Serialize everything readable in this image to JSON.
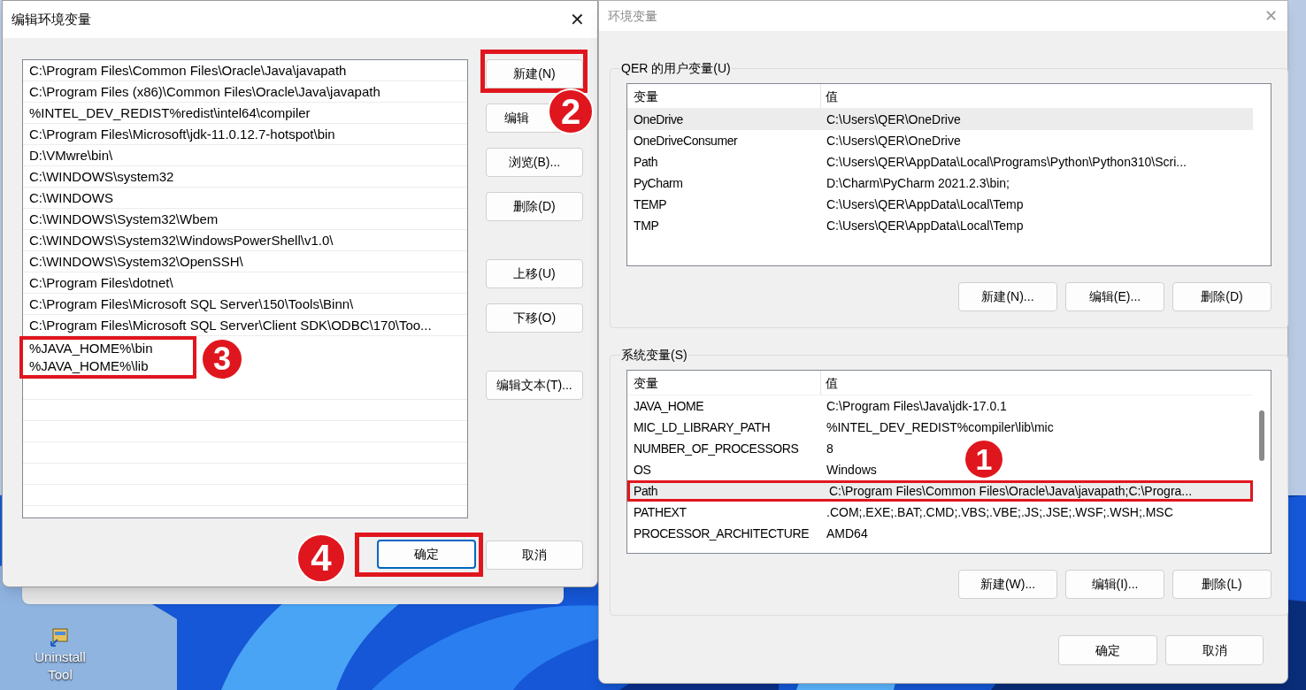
{
  "desktop": {
    "icon_label": "Uninstall Tool"
  },
  "edit_dialog": {
    "title": "编辑环境变量",
    "close": "✕",
    "entries": [
      {
        "text": "C:\\Program Files\\Common Files\\Oracle\\Java\\javapath",
        "highlighted": false
      },
      {
        "text": "C:\\Program Files (x86)\\Common Files\\Oracle\\Java\\javapath",
        "highlighted": false
      },
      {
        "text": "%INTEL_DEV_REDIST%redist\\intel64\\compiler",
        "highlighted": false
      },
      {
        "text": "C:\\Program Files\\Microsoft\\jdk-11.0.12.7-hotspot\\bin",
        "highlighted": false
      },
      {
        "text": "D:\\VMwre\\bin\\",
        "highlighted": false
      },
      {
        "text": "C:\\WINDOWS\\system32",
        "highlighted": false
      },
      {
        "text": "C:\\WINDOWS",
        "highlighted": false
      },
      {
        "text": "C:\\WINDOWS\\System32\\Wbem",
        "highlighted": false
      },
      {
        "text": "C:\\WINDOWS\\System32\\WindowsPowerShell\\v1.0\\",
        "highlighted": false
      },
      {
        "text": "C:\\WINDOWS\\System32\\OpenSSH\\",
        "highlighted": false
      },
      {
        "text": "C:\\Program Files\\dotnet\\",
        "highlighted": false
      },
      {
        "text": "C:\\Program Files\\Microsoft SQL Server\\150\\Tools\\Binn\\",
        "highlighted": false
      },
      {
        "text": "C:\\Program Files\\Microsoft SQL Server\\Client SDK\\ODBC\\170\\Too...",
        "highlighted": false
      },
      {
        "text": "%JAVA_HOME%\\bin",
        "highlighted": true
      },
      {
        "text": "%JAVA_HOME%\\lib",
        "highlighted": true
      }
    ],
    "entries_callout": "3",
    "button_groups": [
      [
        {
          "label": "新建(N)",
          "highlighted": true,
          "callout": "2"
        },
        {
          "label": "编辑",
          "highlighted": false
        },
        {
          "label": "浏览(B)...",
          "highlighted": false
        },
        {
          "label": "删除(D)",
          "highlighted": false
        }
      ],
      [
        {
          "label": "上移(U)",
          "highlighted": false
        },
        {
          "label": "下移(O)",
          "highlighted": false
        }
      ],
      [
        {
          "label": "编辑文本(T)...",
          "highlighted": false
        }
      ]
    ],
    "ok": {
      "label": "确定",
      "highlighted": true,
      "callout": "4"
    },
    "cancel": {
      "label": "取消"
    }
  },
  "env_dialog": {
    "title": "环境变量",
    "close": "✕",
    "groups": [
      {
        "label": "QER 的用户变量(U)",
        "columns": [
          "变量",
          "值"
        ],
        "scrollbar": false,
        "rows": [
          {
            "name": "OneDrive",
            "value": "C:\\Users\\QER\\OneDrive",
            "selected": true,
            "highlighted": false
          },
          {
            "name": "OneDriveConsumer",
            "value": "C:\\Users\\QER\\OneDrive",
            "selected": false,
            "highlighted": false
          },
          {
            "name": "Path",
            "value": "C:\\Users\\QER\\AppData\\Local\\Programs\\Python\\Python310\\Scri...",
            "selected": false,
            "highlighted": false
          },
          {
            "name": "PyCharm",
            "value": "D:\\Charm\\PyCharm 2021.2.3\\bin;",
            "selected": false,
            "highlighted": false
          },
          {
            "name": "TEMP",
            "value": "C:\\Users\\QER\\AppData\\Local\\Temp",
            "selected": false,
            "highlighted": false
          },
          {
            "name": "TMP",
            "value": "C:\\Users\\QER\\AppData\\Local\\Temp",
            "selected": false,
            "highlighted": false
          }
        ],
        "buttons": [
          "新建(N)...",
          "编辑(E)...",
          "删除(D)"
        ]
      },
      {
        "label": "系统变量(S)",
        "columns": [
          "变量",
          "值"
        ],
        "scrollbar": true,
        "rows": [
          {
            "name": "JAVA_HOME",
            "value": "C:\\Program Files\\Java\\jdk-17.0.1",
            "selected": false,
            "highlighted": false
          },
          {
            "name": "MIC_LD_LIBRARY_PATH",
            "value": "%INTEL_DEV_REDIST%compiler\\lib\\mic",
            "selected": false,
            "highlighted": false
          },
          {
            "name": "NUMBER_OF_PROCESSORS",
            "value": "8",
            "selected": false,
            "highlighted": false
          },
          {
            "name": "OS",
            "value": "Windows",
            "selected": false,
            "highlighted": false
          },
          {
            "name": "Path",
            "value": "C:\\Program Files\\Common Files\\Oracle\\Java\\javapath;C:\\Progra...",
            "selected": true,
            "highlighted": true,
            "callout": "1"
          },
          {
            "name": "PATHEXT",
            "value": ".COM;.EXE;.BAT;.CMD;.VBS;.VBE;.JS;.JSE;.WSF;.WSH;.MSC",
            "selected": false,
            "highlighted": false
          },
          {
            "name": "PROCESSOR_ARCHITECTURE",
            "value": "AMD64",
            "selected": false,
            "highlighted": false
          }
        ],
        "buttons": [
          "新建(W)...",
          "编辑(I)...",
          "删除(L)"
        ]
      }
    ],
    "ok": "确定",
    "cancel": "取消"
  }
}
